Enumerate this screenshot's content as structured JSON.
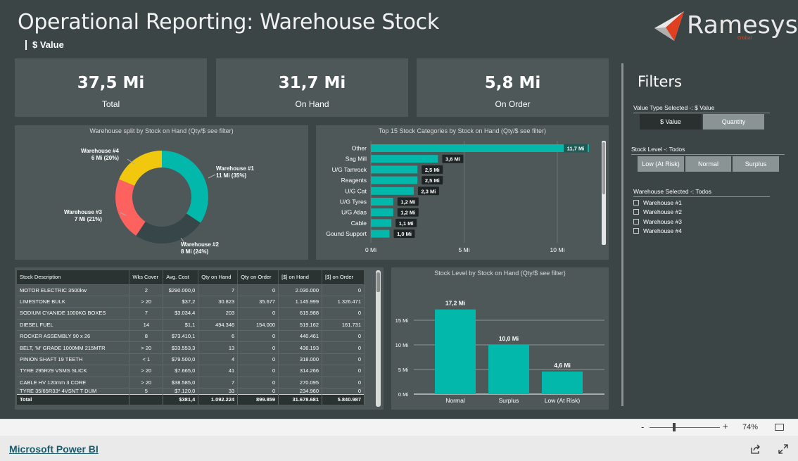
{
  "report": {
    "title": "Operational Reporting: Warehouse Stock",
    "subtitle": "$ Value",
    "logo": {
      "name": "Ramesys",
      "sub": "Global"
    }
  },
  "kpis": [
    {
      "value": "37,5 Mi",
      "label": "Total"
    },
    {
      "value": "31,7 Mi",
      "label": "On Hand"
    },
    {
      "value": "5,8 Mi",
      "label": "On Order"
    }
  ],
  "donut": {
    "title": "Warehouse split by Stock on Hand (Qty/$ see filter)",
    "labels": [
      {
        "name": "Warehouse #1",
        "detail": "11 Mi (35%)"
      },
      {
        "name": "Warehouse #2",
        "detail": "8 Mi (24%)"
      },
      {
        "name": "Warehouse #3",
        "detail": "7 Mi (21%)"
      },
      {
        "name": "Warehouse #4",
        "detail": "6 Mi (20%)"
      }
    ]
  },
  "hbar": {
    "title": "Top 15 Stock Categories by Stock on Hand (Qty/$ see filter)"
  },
  "table": {
    "columns": [
      "Stock Description",
      "Wks Cover",
      "Avg. Cost",
      "Qty on Hand",
      "Qty on Order",
      "[$] on Hand",
      "[$] on Order"
    ],
    "rows": [
      [
        "MOTOR ELECTRIC 3500kw",
        "2",
        "$290.000,0",
        "7",
        "0",
        "2.030.000",
        "0"
      ],
      [
        "LIMESTONE BULK",
        "> 20",
        "$37,2",
        "30.823",
        "35.677",
        "1.145.999",
        "1.326.471"
      ],
      [
        "SODIUM CYANIDE 1000KG BOXES",
        "7",
        "$3.034,4",
        "203",
        "0",
        "615.988",
        "0"
      ],
      [
        "DIESEL FUEL",
        "14",
        "$1,1",
        "494.346",
        "154.000",
        "519.162",
        "161.731"
      ],
      [
        "ROCKER ASSEMBLY 90 x 26",
        "8",
        "$73.410,1",
        "6",
        "0",
        "440.461",
        "0"
      ],
      [
        "BELT, 'M' GRADE 1000MM 215MTR",
        "> 20",
        "$33.553,3",
        "13",
        "0",
        "436.193",
        "0"
      ],
      [
        "PINION SHAFT  19 TEETH",
        "< 1",
        "$79.500,0",
        "4",
        "0",
        "318.000",
        "0"
      ],
      [
        "TYRE 295R29 VSMS SLICK",
        "> 20",
        "$7.665,0",
        "41",
        "0",
        "314.266",
        "0"
      ],
      [
        "CABLE HV 120mm 3 CORE",
        "> 20",
        "$38.585,0",
        "7",
        "0",
        "270.095",
        "0"
      ],
      [
        "TYRE  35/65R33* 4VSNT T DUM",
        "5",
        "$7.120,0",
        "33",
        "0",
        "234.960",
        "0"
      ]
    ],
    "total": [
      "Total",
      "",
      "$381,4",
      "1.092.224",
      "899.859",
      "31.678.681",
      "5.840.987"
    ]
  },
  "vbar": {
    "title": "Stock Level by Stock on Hand (Qty/$ see filter)"
  },
  "filters": {
    "title": "Filters",
    "value_type": {
      "heading": "Value Type Selected -: $ Value",
      "options": [
        "$ Value",
        "Quantity"
      ],
      "selected": "$ Value"
    },
    "stock_level": {
      "heading": "Stock Level -: Todos",
      "options": [
        "Low (At Risk)",
        "Normal",
        "Surplus"
      ]
    },
    "warehouse": {
      "heading": "Warehouse Selected -: Todos",
      "options": [
        "Warehouse #1",
        "Warehouse #2",
        "Warehouse #3",
        "Warehouse #4"
      ]
    }
  },
  "zoom": {
    "minus": "-",
    "plus": "+",
    "level": "74%"
  },
  "footer": {
    "link": "Microsoft Power BI"
  },
  "colors": {
    "teal": "#01b8aa",
    "dark": "#374649",
    "red": "#fd625e",
    "yellow": "#f2c80f",
    "bg": "#3b4545",
    "card": "#4e5858"
  },
  "chart_data": [
    {
      "type": "pie",
      "title": "Warehouse split by Stock on Hand (Qty/$ see filter)",
      "categories": [
        "Warehouse #1",
        "Warehouse #2",
        "Warehouse #3",
        "Warehouse #4"
      ],
      "values": [
        11,
        8,
        7,
        6
      ],
      "percentages": [
        35,
        24,
        21,
        20
      ],
      "colors": [
        "#01b8aa",
        "#374649",
        "#fd625e",
        "#f2c80f"
      ]
    },
    {
      "type": "bar",
      "orientation": "horizontal",
      "title": "Top 15 Stock Categories by Stock on Hand (Qty/$ see filter)",
      "categories": [
        "Other",
        "Sag Mill",
        "U/G Tamrock",
        "Reagents",
        "U/G Cat",
        "U/G Tyres",
        "U/G Atlas",
        "Cable",
        "Gound Support"
      ],
      "values": [
        11.7,
        3.6,
        2.5,
        2.5,
        2.3,
        1.2,
        1.2,
        1.1,
        1.0
      ],
      "value_labels": [
        "11,7 Mi",
        "3,6 Mi",
        "2,5 Mi",
        "2,5 Mi",
        "2,3 Mi",
        "1,2 Mi",
        "1,2 Mi",
        "1,1 Mi",
        "1,0 Mi"
      ],
      "xticks": [
        "0 Mi",
        "5 Mi",
        "10 Mi"
      ],
      "xlim": [
        0,
        11.7
      ],
      "grid": true
    },
    {
      "type": "bar",
      "title": "Stock Level by Stock on Hand (Qty/$ see filter)",
      "categories": [
        "Normal",
        "Surplus",
        "Low (At Risk)"
      ],
      "values": [
        17.2,
        10.0,
        4.6
      ],
      "value_labels": [
        "17,2 Mi",
        "10,0 Mi",
        "4,6 Mi"
      ],
      "yticks": [
        "0 Mi",
        "5 Mi",
        "10 Mi",
        "15 Mi"
      ],
      "ylim": [
        0,
        20
      ],
      "grid": true
    }
  ]
}
